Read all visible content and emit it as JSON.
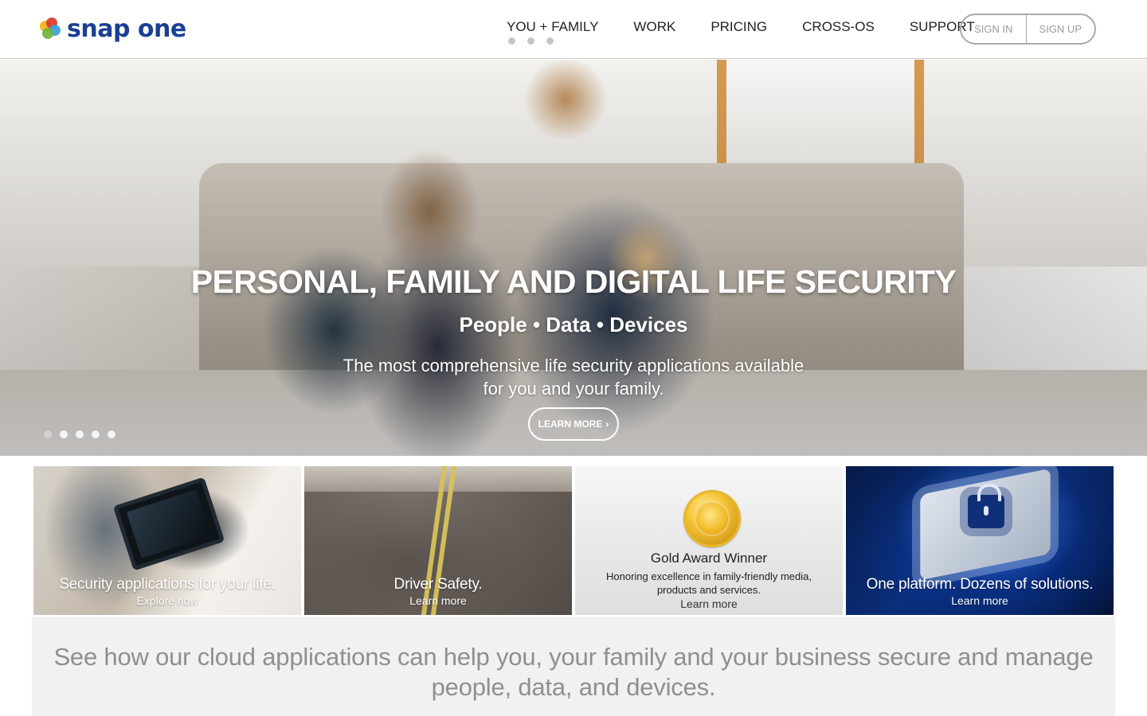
{
  "brand": {
    "name": "snap one"
  },
  "nav": {
    "items": [
      {
        "label": "YOU + FAMILY"
      },
      {
        "label": "WORK"
      },
      {
        "label": "PRICING"
      },
      {
        "label": "CROSS-OS"
      },
      {
        "label": "SUPPORT"
      }
    ],
    "auth": {
      "sign_in": "SIGN IN",
      "sign_up": "SIGN UP"
    }
  },
  "hero": {
    "title": "PERSONAL, FAMILY AND DIGITAL LIFE SECURITY",
    "subtitle": "People • Data • Devices",
    "description": "The most comprehensive life security applications available for you and your family.",
    "cta": {
      "label": "LEARN MORE",
      "chevron": "›"
    },
    "carousel": {
      "total": 5,
      "active_index": 0
    }
  },
  "tiles": [
    {
      "title": "Security applications for your life.",
      "link": "Explore now"
    },
    {
      "title": "Driver Safety.",
      "link": "Learn more"
    },
    {
      "title": "Gold Award Winner",
      "desc": "Honoring excellence in family-friendly media, products and services.",
      "link": "Learn more"
    },
    {
      "title": "One platform. Dozens of solutions.",
      "link": "Learn more"
    }
  ],
  "bottom": {
    "text": "See how our cloud applications can help you, your family and your business secure and manage people, data, and devices."
  },
  "colors": {
    "brand_blue": "#1b3f93",
    "header_border": "#c9c9c9",
    "muted_text": "#8f8f8f"
  },
  "icons": {
    "logo": "snap-one-logo-icon",
    "chevron": "chevron-right-icon",
    "award": "gold-award-seal-icon",
    "lock": "lock-icon"
  }
}
